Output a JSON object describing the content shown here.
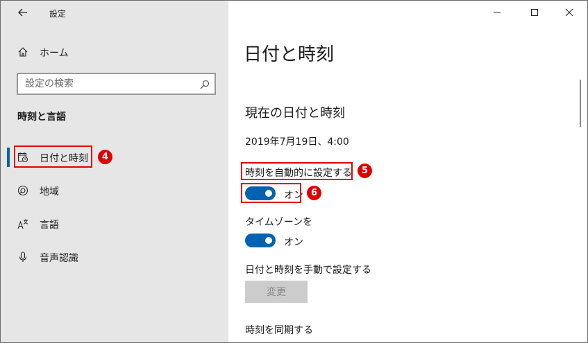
{
  "window": {
    "title": "設定"
  },
  "sidebar": {
    "home_label": "ホーム",
    "search_placeholder": "設定の検索",
    "section_title": "時刻と言語",
    "items": [
      {
        "label": "日付と時刻",
        "icon": "calendar-clock-icon",
        "active": true
      },
      {
        "label": "地域",
        "icon": "globe-icon",
        "active": false
      },
      {
        "label": "言語",
        "icon": "language-icon",
        "active": false
      },
      {
        "label": "音声認識",
        "icon": "microphone-icon",
        "active": false
      }
    ]
  },
  "main": {
    "page_title": "日付と時刻",
    "current_heading": "現在の日付と時刻",
    "current_datetime": "2019年7月19日、4:00",
    "auto_time_label": "時刻を自動的に設定する",
    "auto_time_state": "オン",
    "timezone_label": "タイムゾーンを",
    "timezone_state": "オン",
    "manual_label": "日付と時刻を手動で設定する",
    "change_button": "変更",
    "sync_label": "時刻を同期する"
  },
  "annotations": {
    "badge_4": "4",
    "badge_5": "5",
    "badge_6": "6"
  },
  "colors": {
    "accent": "#0063b1",
    "highlight": "#e00000",
    "sidebar_bg": "#e6e6e6"
  }
}
